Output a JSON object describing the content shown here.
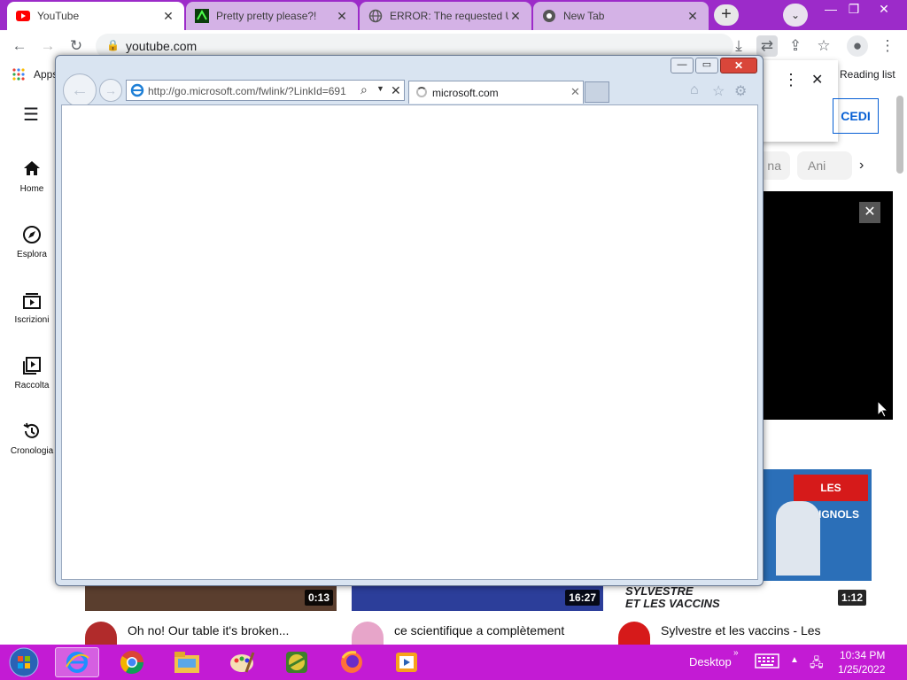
{
  "chrome": {
    "tabs": [
      {
        "title": "YouTube",
        "icon": "youtube-icon",
        "active": true
      },
      {
        "title": "Pretty pretty please?!",
        "icon": "green-page-icon",
        "active": false
      },
      {
        "title": "ERROR: The requested U",
        "icon": "globe-icon",
        "active": false
      },
      {
        "title": "New Tab",
        "icon": "chrome-icon",
        "active": false
      }
    ],
    "new_tab": "+",
    "tab_search": "⌄",
    "omnibox_url": "youtube.com",
    "apps_label": "Apps",
    "reading_list": "Reading list"
  },
  "youtube": {
    "nav": [
      {
        "label": "Home",
        "icon": "home-icon"
      },
      {
        "label": "Esplora",
        "icon": "explore-icon"
      },
      {
        "label": "Iscrizioni",
        "icon": "subscriptions-icon"
      },
      {
        "label": "Raccolta",
        "icon": "library-icon"
      },
      {
        "label": "Cronologia",
        "icon": "history-icon"
      }
    ],
    "signin": "CEDI",
    "chips": [
      "na",
      "Ani"
    ],
    "videos": [
      {
        "title": "Oh no! Our table it's broken...",
        "duration": "0:13"
      },
      {
        "title": "ce scientifique a complètement",
        "duration": "16:27"
      },
      {
        "title": "Sylvestre et les vaccins - Les",
        "duration": "1:12"
      }
    ],
    "thumb_banner": "LES GUIGNOLS",
    "thumb_caption_1": "SYLVESTRE",
    "thumb_caption_2": "ET LES VACCINS"
  },
  "ie": {
    "address": "http://go.microsoft.com/fwlink/?LinkId=691",
    "address_host": "microsoft.com",
    "tab_title": "microsoft.com"
  },
  "taskbar": {
    "desktop_label": "Desktop",
    "time": "10:34 PM",
    "date": "1/25/2022"
  },
  "colors": {
    "chrome_frame": "#9c2bc9",
    "taskbar": "#c31bd4",
    "youtube_red": "#ff0000"
  }
}
